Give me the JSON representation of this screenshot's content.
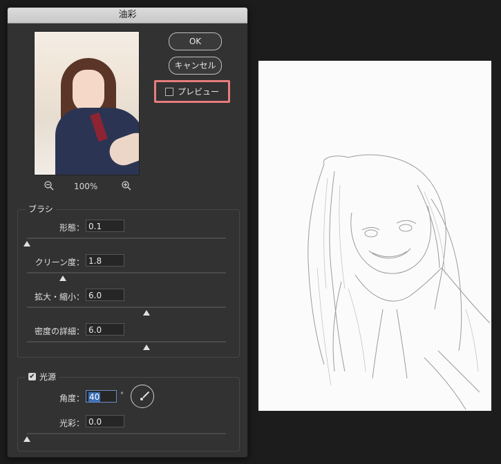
{
  "dialog": {
    "title": "油彩",
    "zoom_level": "100%",
    "buttons": {
      "ok": "OK",
      "cancel": "キャンセル"
    },
    "preview_label": "プレビュー",
    "preview_checked": false,
    "brush": {
      "title": "ブラシ",
      "params": [
        {
          "label": "形態：",
          "value": "0.1",
          "slider_fraction": 0.0
        },
        {
          "label": "クリーン度：",
          "value": "1.8",
          "slider_fraction": 0.18
        },
        {
          "label": "拡大・縮小：",
          "value": "6.0",
          "slider_fraction": 0.6
        },
        {
          "label": "密度の詳細：",
          "value": "6.0",
          "slider_fraction": 0.6
        }
      ]
    },
    "lighting": {
      "title": "光源",
      "enabled": true,
      "angle_label": "角度：",
      "angle_value": "40",
      "angle_unit": "°",
      "shine_label": "光彩：",
      "shine_value": "0.0",
      "shine_slider_fraction": 0.0
    }
  },
  "icons": {
    "zoom_out": "zoom-out-icon",
    "zoom_in": "zoom-in-icon"
  },
  "colors": {
    "preview_highlight": "#e87d7d",
    "dialog_bg": "#323232",
    "selection_blue": "#3b6fb6"
  }
}
